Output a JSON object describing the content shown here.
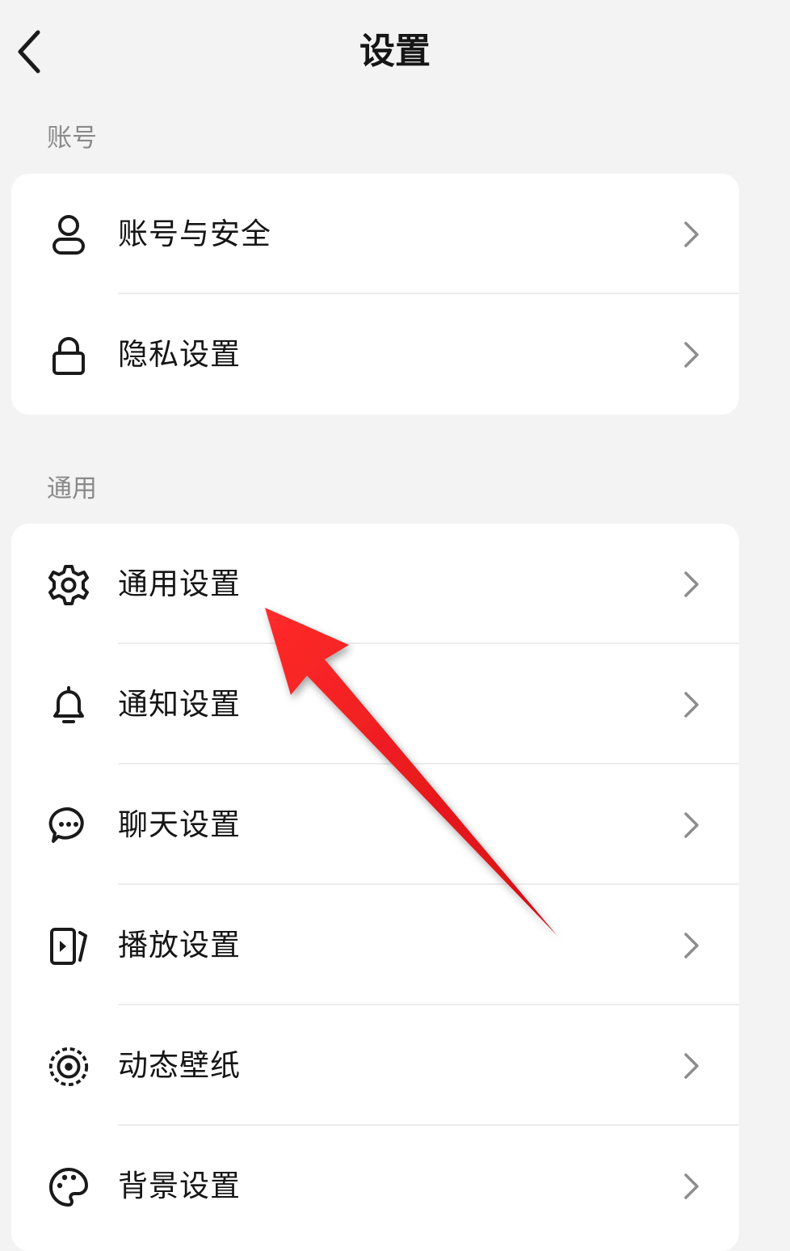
{
  "header": {
    "title": "设置"
  },
  "sections": [
    {
      "label": "账号",
      "items": [
        {
          "label": "账号与安全",
          "icon": "person-icon"
        },
        {
          "label": "隐私设置",
          "icon": "lock-icon"
        }
      ]
    },
    {
      "label": "通用",
      "items": [
        {
          "label": "通用设置",
          "icon": "gear-icon"
        },
        {
          "label": "通知设置",
          "icon": "bell-icon"
        },
        {
          "label": "聊天设置",
          "icon": "chat-bubble-icon"
        },
        {
          "label": "播放设置",
          "icon": "play-screen-icon"
        },
        {
          "label": "动态壁纸",
          "icon": "live-wallpaper-icon"
        },
        {
          "label": "背景设置",
          "icon": "palette-icon"
        }
      ]
    }
  ],
  "annotation": {
    "type": "red-arrow-pointing-to",
    "target": "通用设置",
    "color": "#e8141b"
  }
}
